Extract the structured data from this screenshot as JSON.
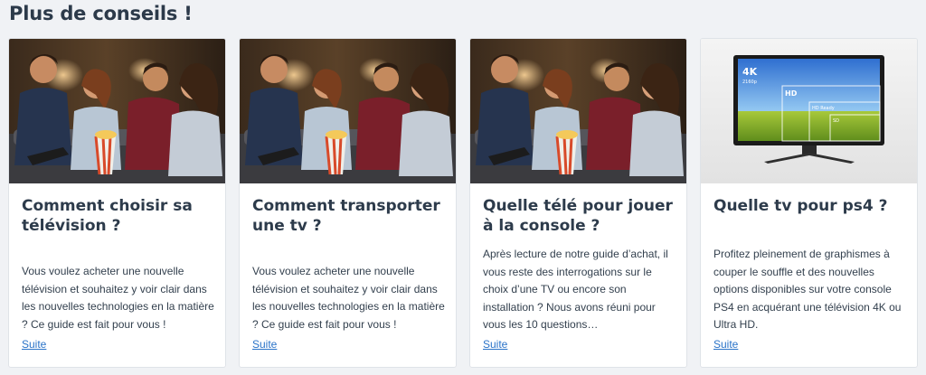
{
  "section": {
    "title": "Plus de conseils !"
  },
  "cards": [
    {
      "image": "friends-watching-tv-with-popcorn",
      "title": "Comment choisir sa télévision ?",
      "text": "Vous voulez acheter une nouvelle télévision et souhaitez y voir clair dans les nouvelles technologies en la matière ? Ce guide est fait pour vous !",
      "link": "Suite"
    },
    {
      "image": "friends-watching-tv-with-popcorn",
      "title": "Comment transporter une tv ?",
      "text": "Vous voulez acheter une nouvelle télévision et souhaitez y voir clair dans les nouvelles technologies en la matière ? Ce guide est fait pour vous !",
      "link": "Suite"
    },
    {
      "image": "friends-watching-tv-with-popcorn",
      "title": "Quelle télé pour jouer à la console ?",
      "text": "Après lecture de notre guide d’achat, il vous reste des interrogations sur le choix d’une TV ou encore son installation ? Nous avons réuni pour vous les 10 questions…",
      "link": "Suite"
    },
    {
      "image": "tv-resolution-comparison",
      "title": "Quelle tv pour ps4 ?",
      "text": "Profitez pleinement de graphismes à couper le souffle et des nouvelles options disponibles sur votre console PS4 en acquérant une télévision 4K ou Ultra HD.",
      "link": "Suite",
      "screen_labels": {
        "uhd": "4K",
        "uhd_sub": "2160p",
        "hd": "HD",
        "hd_ready": "HD Ready",
        "sd": "SD"
      }
    }
  ]
}
